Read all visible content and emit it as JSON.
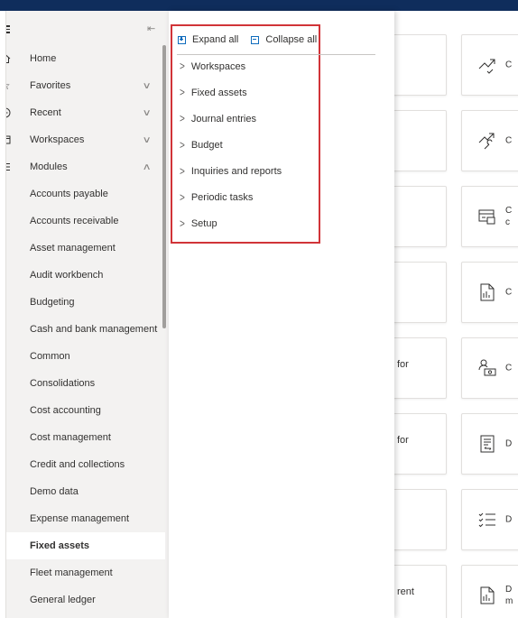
{
  "nav": {
    "items": [
      {
        "label": "Home",
        "icon": "home-icon",
        "chevron": ""
      },
      {
        "label": "Favorites",
        "icon": "star-icon",
        "chevron": "∨"
      },
      {
        "label": "Recent",
        "icon": "clock-icon",
        "chevron": "∨"
      },
      {
        "label": "Workspaces",
        "icon": "workspace-icon",
        "chevron": "∨"
      },
      {
        "label": "Modules",
        "icon": "list-icon",
        "chevron": "∧"
      }
    ],
    "modules": [
      "Accounts payable",
      "Accounts receivable",
      "Asset management",
      "Audit workbench",
      "Budgeting",
      "Cash and bank management",
      "Common",
      "Consolidations",
      "Cost accounting",
      "Cost management",
      "Credit and collections",
      "Demo data",
      "Expense management",
      "Fixed assets",
      "Fleet management",
      "General ledger"
    ],
    "active_module": "Fixed assets"
  },
  "flyout": {
    "expand_all": "Expand all",
    "collapse_all": "Collapse all",
    "groups": [
      "Workspaces",
      "Fixed assets",
      "Journal entries",
      "Budget",
      "Inquiries and reports",
      "Periodic tasks",
      "Setup"
    ]
  },
  "tiles": {
    "left_texts": [
      "for",
      "for",
      "rent"
    ],
    "right": [
      {
        "label": "C",
        "icon": "trend-icon"
      },
      {
        "label": "C",
        "icon": "trend-wrench-icon"
      },
      {
        "label": "C\nc",
        "icon": "card-icon"
      },
      {
        "label": "C",
        "icon": "document-chart-icon"
      },
      {
        "label": "C",
        "icon": "user-money-icon"
      },
      {
        "label": "D",
        "icon": "document-arrows-icon"
      },
      {
        "label": "D",
        "icon": "checklist-icon"
      },
      {
        "label": "D\nm",
        "icon": "document-chart-icon"
      }
    ]
  },
  "colors": {
    "accent": "#0f6cbd",
    "highlight_box": "#d13438",
    "nav_bg": "#f3f2f1",
    "topbar": "#0f2d5c"
  }
}
